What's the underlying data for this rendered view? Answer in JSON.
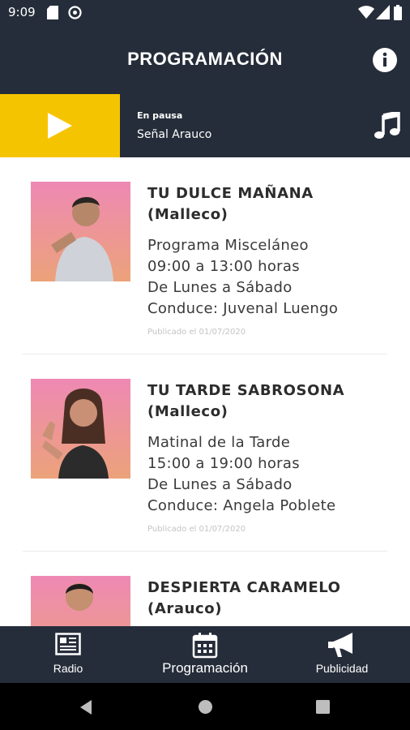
{
  "status_bar": {
    "time": "9:09",
    "icons": [
      "sd-card-icon",
      "data-saver-icon",
      "wifi-icon",
      "signal-icon",
      "battery-icon"
    ]
  },
  "app_bar": {
    "title": "PROGRAMACIÓN",
    "info_icon": "info-icon"
  },
  "player": {
    "status": "En pausa",
    "station": "Señal Arauco",
    "accent_color": "#f5c400",
    "play_icon": "play-icon",
    "music_icon": "music-note-icon"
  },
  "programs": [
    {
      "title_line1": "TU DULCE MAÑANA",
      "title_line2": "(Malleco)",
      "lines": [
        "Programa Misceláneo",
        "09:00 a 13:00 horas",
        "De Lunes a Sábado",
        "Conduce: Juvenal Luengo"
      ],
      "published": "Publicado el 01/07/2020"
    },
    {
      "title_line1": "TU TARDE SABROSONA",
      "title_line2": "(Malleco)",
      "lines": [
        "Matinal de la Tarde",
        "15:00 a 19:00 horas",
        "De Lunes a Sábado",
        "Conduce: Angela Poblete"
      ],
      "published": "Publicado el 01/07/2020"
    },
    {
      "title_line1": "DESPIERTA CARAMELO",
      "title_line2": "(Arauco)"
    }
  ],
  "bottom_nav": {
    "items": [
      {
        "label": "Radio",
        "icon": "newspaper-icon"
      },
      {
        "label": "Programación",
        "icon": "calendar-icon"
      },
      {
        "label": "Publicidad",
        "icon": "megaphone-icon"
      }
    ],
    "background": "#262d3a"
  },
  "system_nav": {
    "icons": [
      "back-icon",
      "home-icon",
      "recents-icon"
    ]
  }
}
